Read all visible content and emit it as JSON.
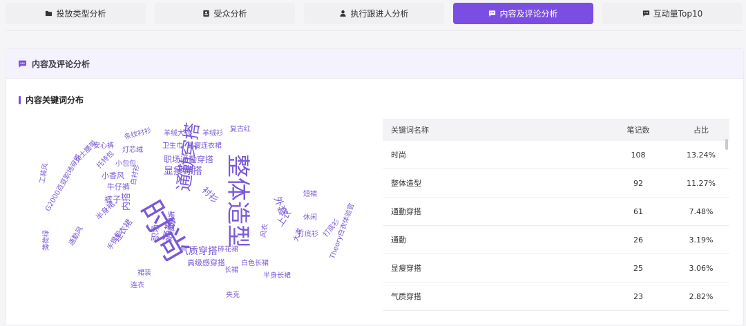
{
  "tabs": [
    {
      "label": "投放类型分析",
      "icon": "folder-icon",
      "active": false
    },
    {
      "label": "受众分析",
      "icon": "id-card-icon",
      "active": false
    },
    {
      "label": "执行跟进人分析",
      "icon": "user-icon",
      "active": false
    },
    {
      "label": "内容及评论分析",
      "icon": "comment-icon",
      "active": true
    },
    {
      "label": "互动量Top10",
      "icon": "comment-icon",
      "active": false
    }
  ],
  "panel": {
    "title": "内容及评论分析",
    "section_title": "内容关键词分布"
  },
  "colors": {
    "accent": "#7b4ee3",
    "word": "#7b59d8",
    "panel_header_bg": "#f4f2fd"
  },
  "wordcloud": [
    "时尚",
    "整体造型",
    "通勤穿搭",
    "通勤",
    "显瘦穿搭",
    "气质穿搭",
    "职场",
    "外套",
    "上衣",
    "裤子",
    "内搭",
    "职场通勤穿搭",
    "牛仔裤",
    "高级感穿搭",
    "衬衫",
    "连衣裙",
    "小香风",
    "白衬衫",
    "打底衫",
    "半身裙",
    "长裙",
    "阔腿裤",
    "短裙",
    "风衣",
    "大衣",
    "羊绒大衣",
    "卫生巾",
    "显瘦连衣裙",
    "羊绒衫",
    "复古红",
    "条纹衬衫",
    "安心裤",
    "灯芯绒",
    "女士腰带",
    "托特包",
    "工装风",
    "手提包",
    "小包包",
    "碎花裙",
    "白色长裙",
    "半身长裙",
    "夹克",
    "打底衫",
    "休闲",
    "Theory白衣体验官",
    "G2000百变职场穿搭",
    "薄荷绿",
    "通勤风",
    "裙装",
    "连衣"
  ],
  "table": {
    "headers": [
      "关键词名称",
      "笔记数",
      "占比"
    ],
    "rows": [
      {
        "name": "时尚",
        "count": "108",
        "ratio": "13.24%"
      },
      {
        "name": "整体造型",
        "count": "92",
        "ratio": "11.27%"
      },
      {
        "name": "通勤穿搭",
        "count": "61",
        "ratio": "7.48%"
      },
      {
        "name": "通勤",
        "count": "26",
        "ratio": "3.19%"
      },
      {
        "name": "显瘦穿搭",
        "count": "25",
        "ratio": "3.06%"
      },
      {
        "name": "气质穿搭",
        "count": "23",
        "ratio": "2.82%"
      }
    ]
  }
}
